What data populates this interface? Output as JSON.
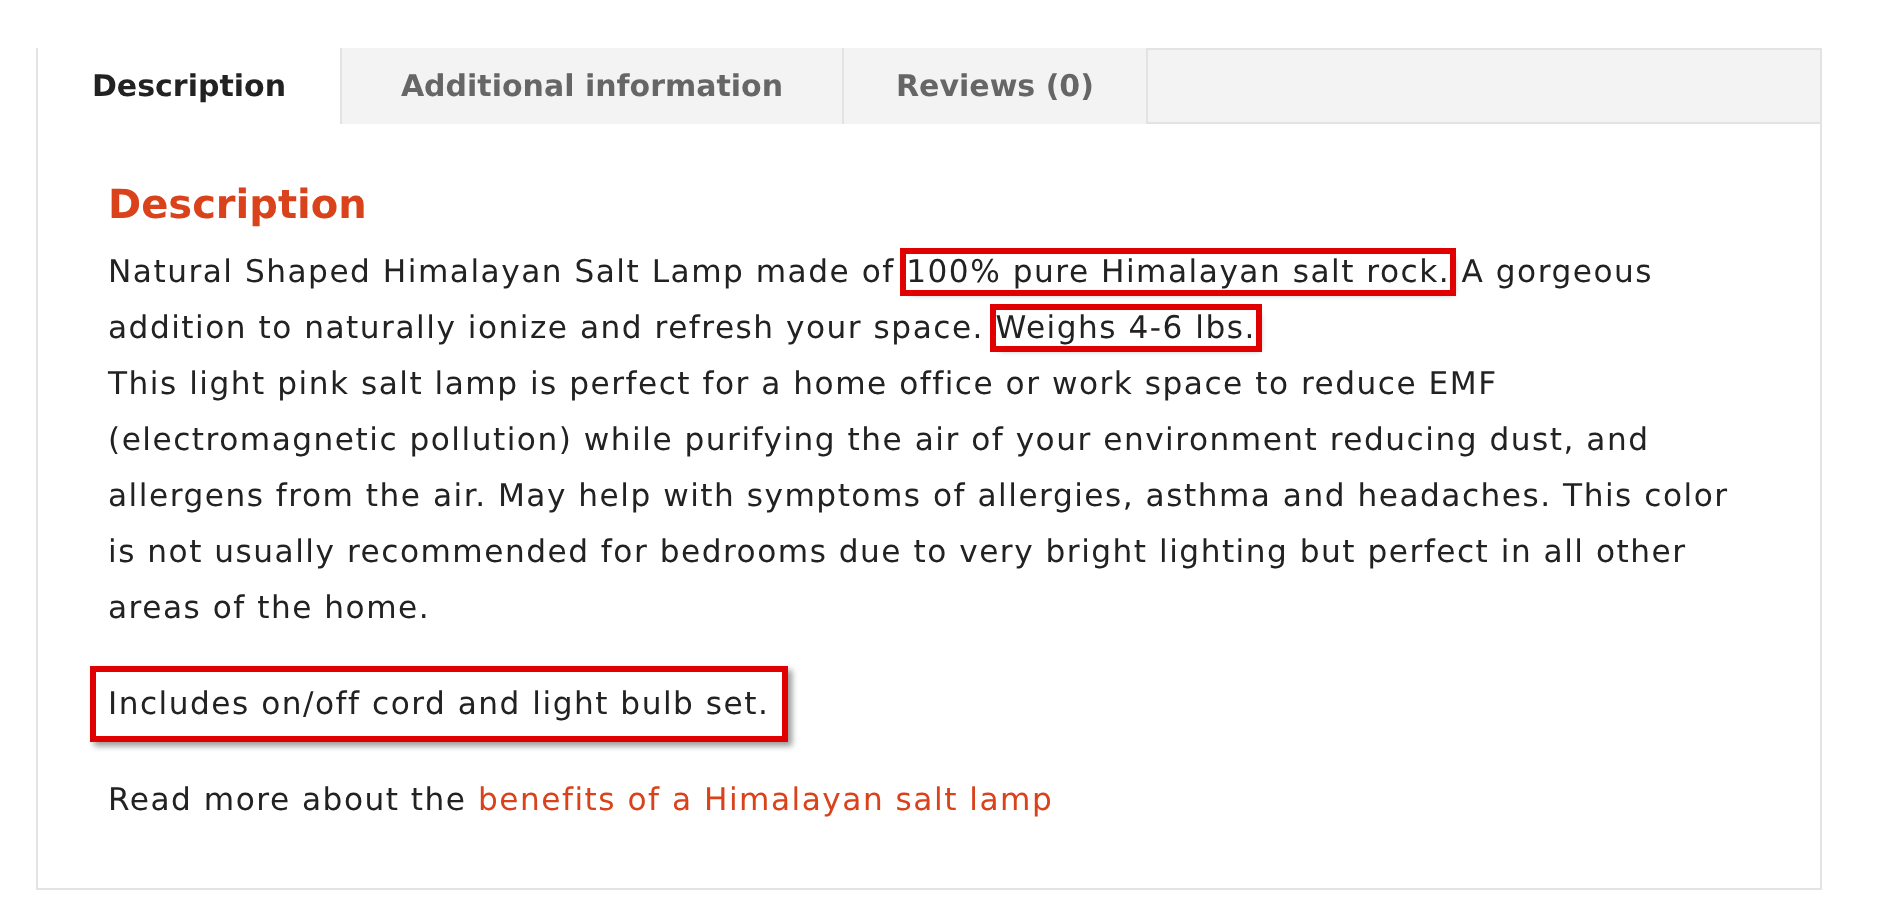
{
  "tabs": [
    {
      "label": "Description",
      "selected": true
    },
    {
      "label": "Additional information",
      "selected": false
    },
    {
      "label": "Reviews (0)",
      "selected": false
    }
  ],
  "panel": {
    "heading": "Description",
    "paragraphs": [
      {
        "highlighted": false,
        "lines": [
          [
            {
              "text": "Natural Shaped Himalayan Salt Lamp made of ",
              "highlighted": false
            },
            {
              "text": "100% pure Himalayan salt rock.",
              "highlighted": true
            },
            {
              "text": " A gorgeous addition to naturally ionize and refresh your space. ",
              "highlighted": false
            },
            {
              "text": "Weighs 4-6 lbs.",
              "highlighted": true
            }
          ],
          [
            {
              "text": "This light pink salt lamp is perfect for a home office or work space to reduce EMF (electromagnetic pollution) while purifying the air of your environment reducing dust, and allergens from the air. May help with symptoms of allergies, asthma and headaches. This color is not usually recommended for bedrooms due to very bright lighting but perfect in all other areas of the home.",
              "highlighted": false
            }
          ]
        ]
      },
      {
        "highlighted": true,
        "lines": [
          [
            {
              "text": "Includes on/off cord and light bulb set.",
              "highlighted": false
            }
          ]
        ]
      },
      {
        "highlighted": false,
        "lines": [
          [
            {
              "text": "Read more about the ",
              "highlighted": false
            }
          ]
        ],
        "link": "benefits of a Himalayan salt lamp"
      }
    ]
  }
}
